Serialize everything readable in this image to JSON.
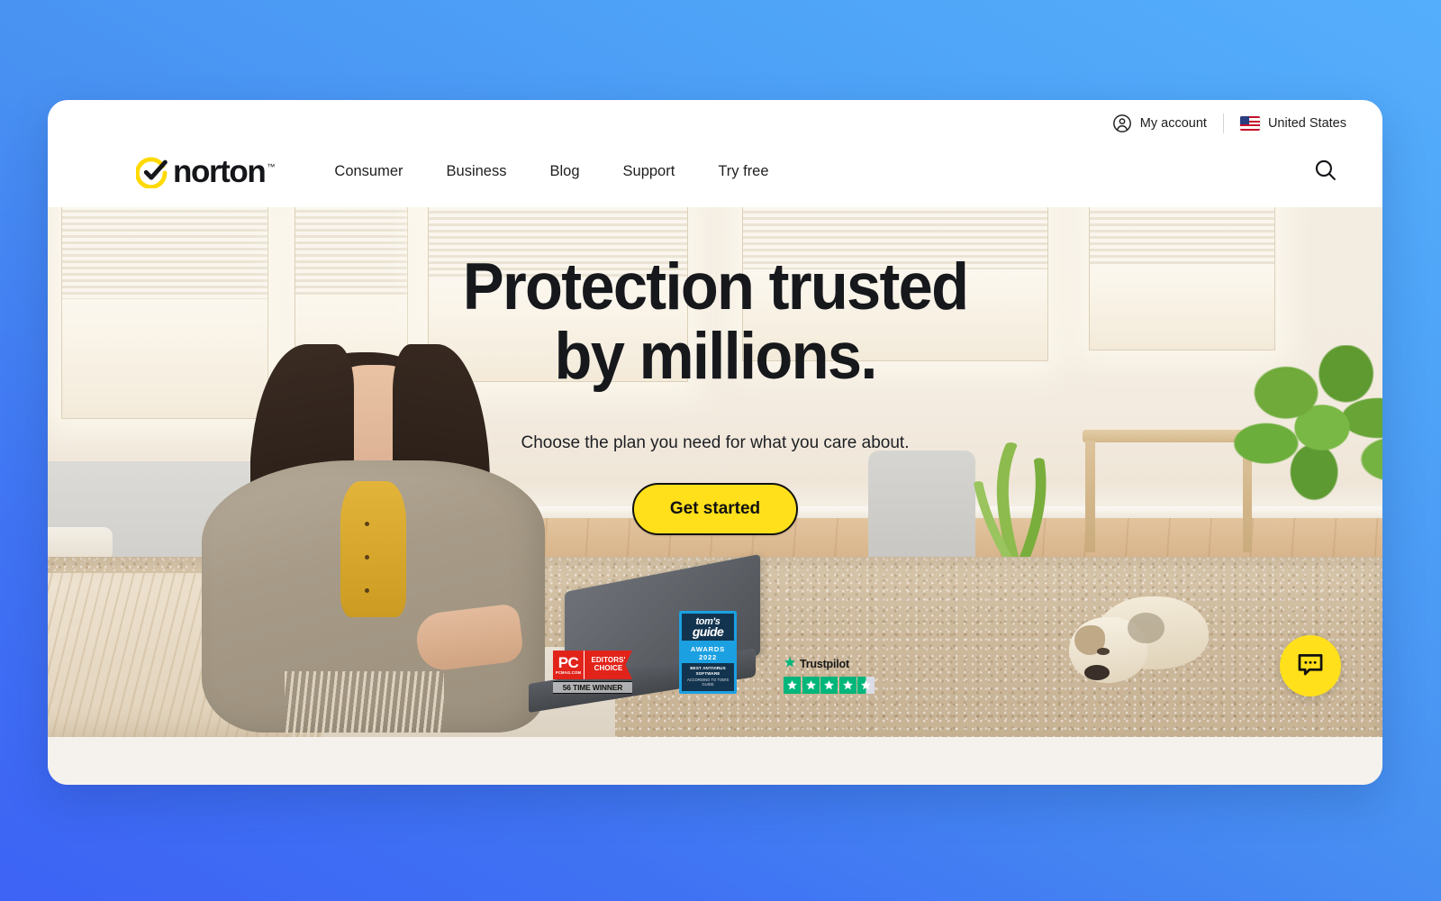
{
  "theme": {
    "brand_yellow": "#ffe01b",
    "backdrop_blue_start": "#3d63f5",
    "backdrop_blue_end": "#55aefb",
    "card_white": "#ffffff",
    "trustpilot_green": "#00b67a",
    "pcmag_red": "#e2231a",
    "tomsguide_blue": "#1ba0e2"
  },
  "utility": {
    "account_label": "My account",
    "account_icon": "user-circle-icon",
    "country_label": "United States",
    "country_icon": "us-flag-icon"
  },
  "logo": {
    "wordmark": "norton",
    "trademark": "™",
    "mark_icon": "norton-checkmark-icon"
  },
  "nav": {
    "items": [
      {
        "label": "Consumer"
      },
      {
        "label": "Business"
      },
      {
        "label": "Blog"
      },
      {
        "label": "Support"
      },
      {
        "label": "Try free"
      }
    ],
    "search_icon": "search-icon"
  },
  "hero": {
    "title_line1": "Protection trusted",
    "title_line2": "by millions.",
    "subtitle": "Choose the plan you need for what you care about.",
    "cta_label": "Get started"
  },
  "badges": {
    "pcmag": {
      "brand": "PC",
      "brand_sub": "PCMAG.COM",
      "award_line1": "EDITORS'",
      "award_line2": "CHOICE",
      "footer": "56 TIME WINNER"
    },
    "tomsguide": {
      "brand_line1": "tom's",
      "brand_line2": "guide",
      "award": "AWARDS 2022",
      "fine_line1": "BEST ANTIVIRUS SOFTWARE",
      "fine_line2": "ACCORDING TO TOM'S GUIDE"
    },
    "trustpilot": {
      "name": "Trustpilot",
      "logo_icon": "trustpilot-star-icon",
      "rating": 4.5,
      "max_rating": 5,
      "stars": [
        "full",
        "full",
        "full",
        "full",
        "half"
      ]
    }
  },
  "chat": {
    "icon": "chat-bubble-icon",
    "label": "Chat"
  }
}
